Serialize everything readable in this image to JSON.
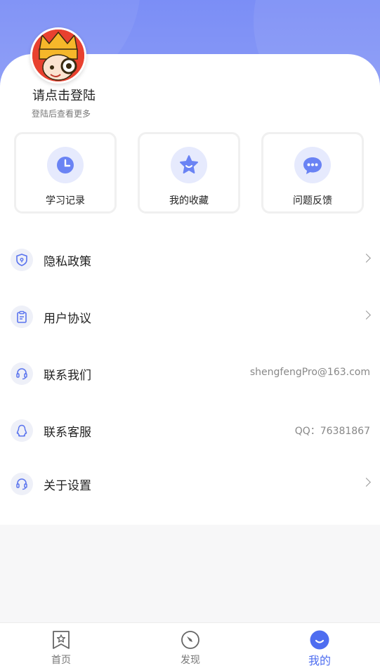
{
  "profile": {
    "title": "请点击登陆",
    "subtitle": "登陆后查看更多"
  },
  "quick_actions": [
    {
      "label": "学习记录",
      "icon": "clock-icon"
    },
    {
      "label": "我的收藏",
      "icon": "star-icon"
    },
    {
      "label": "问题反馈",
      "icon": "chat-icon"
    }
  ],
  "menu": [
    {
      "label": "隐私政策",
      "icon": "shield-icon",
      "value": "",
      "chevron": true
    },
    {
      "label": "用户协议",
      "icon": "clipboard-icon",
      "value": "",
      "chevron": true
    },
    {
      "label": "联系我们",
      "icon": "headset-icon",
      "value": "shengfengPro@163.com",
      "chevron": false
    },
    {
      "label": "联系客服",
      "icon": "qq-penguin-icon",
      "value": "QQ：76381867",
      "chevron": false
    },
    {
      "label": "关于设置",
      "icon": "headset-icon",
      "value": "",
      "chevron": true
    }
  ],
  "tabbar": [
    {
      "label": "首页",
      "icon": "bookmark-star-icon",
      "active": false
    },
    {
      "label": "发现",
      "icon": "compass-icon",
      "active": false
    },
    {
      "label": "我的",
      "icon": "smile-icon",
      "active": true
    }
  ],
  "colors": {
    "accent": "#4e6df0",
    "header": "#7b8ef6",
    "icon_bg": "#e6eafd"
  }
}
